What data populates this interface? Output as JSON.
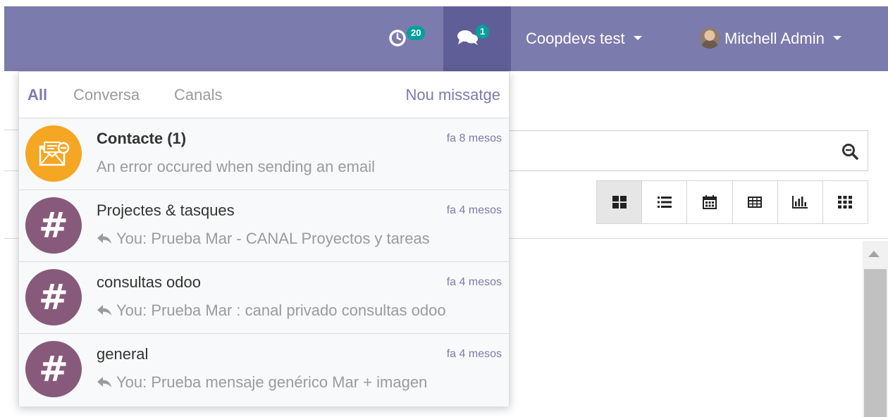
{
  "navbar": {
    "activity_count": "20",
    "messaging_count": "1",
    "company": "Coopdevs test",
    "user": "Mitchell Admin"
  },
  "dropdown": {
    "tabs": [
      {
        "label": "All",
        "active": true
      },
      {
        "label": "Conversa",
        "active": false
      },
      {
        "label": "Canals",
        "active": false
      }
    ],
    "new_message": "Nou missatge",
    "items": [
      {
        "name": "Contacte (1)",
        "date": "fa 8 mesos",
        "preview": "An error occured when sending an email",
        "icon": "email-error-icon",
        "bold": true
      },
      {
        "name": "Projectes & tasques",
        "date": "fa 4 mesos",
        "preview": "You: Prueba Mar - CANAL Proyectos y tareas",
        "icon": "hashtag-icon",
        "bold": false
      },
      {
        "name": "consultas odoo",
        "date": "fa 4 mesos",
        "preview": "You: Prueba Mar : canal privado consultas odoo",
        "icon": "hashtag-icon",
        "bold": false
      },
      {
        "name": "general",
        "date": "fa 4 mesos",
        "preview": "You: Prueba mensaje genérico Mar + imagen",
        "icon": "hashtag-icon",
        "bold": false
      }
    ]
  },
  "view_switcher": [
    "kanban-view-icon",
    "list-view-icon",
    "calendar-view-icon",
    "pivot-view-icon",
    "graph-view-icon",
    "grid-view-icon"
  ],
  "colors": {
    "navbar": "#7c7bad",
    "navbar_active": "#5f5e97",
    "badge": "#00a09d",
    "channel_avatar": "#875a7b",
    "mail_avatar": "#f5a623"
  }
}
